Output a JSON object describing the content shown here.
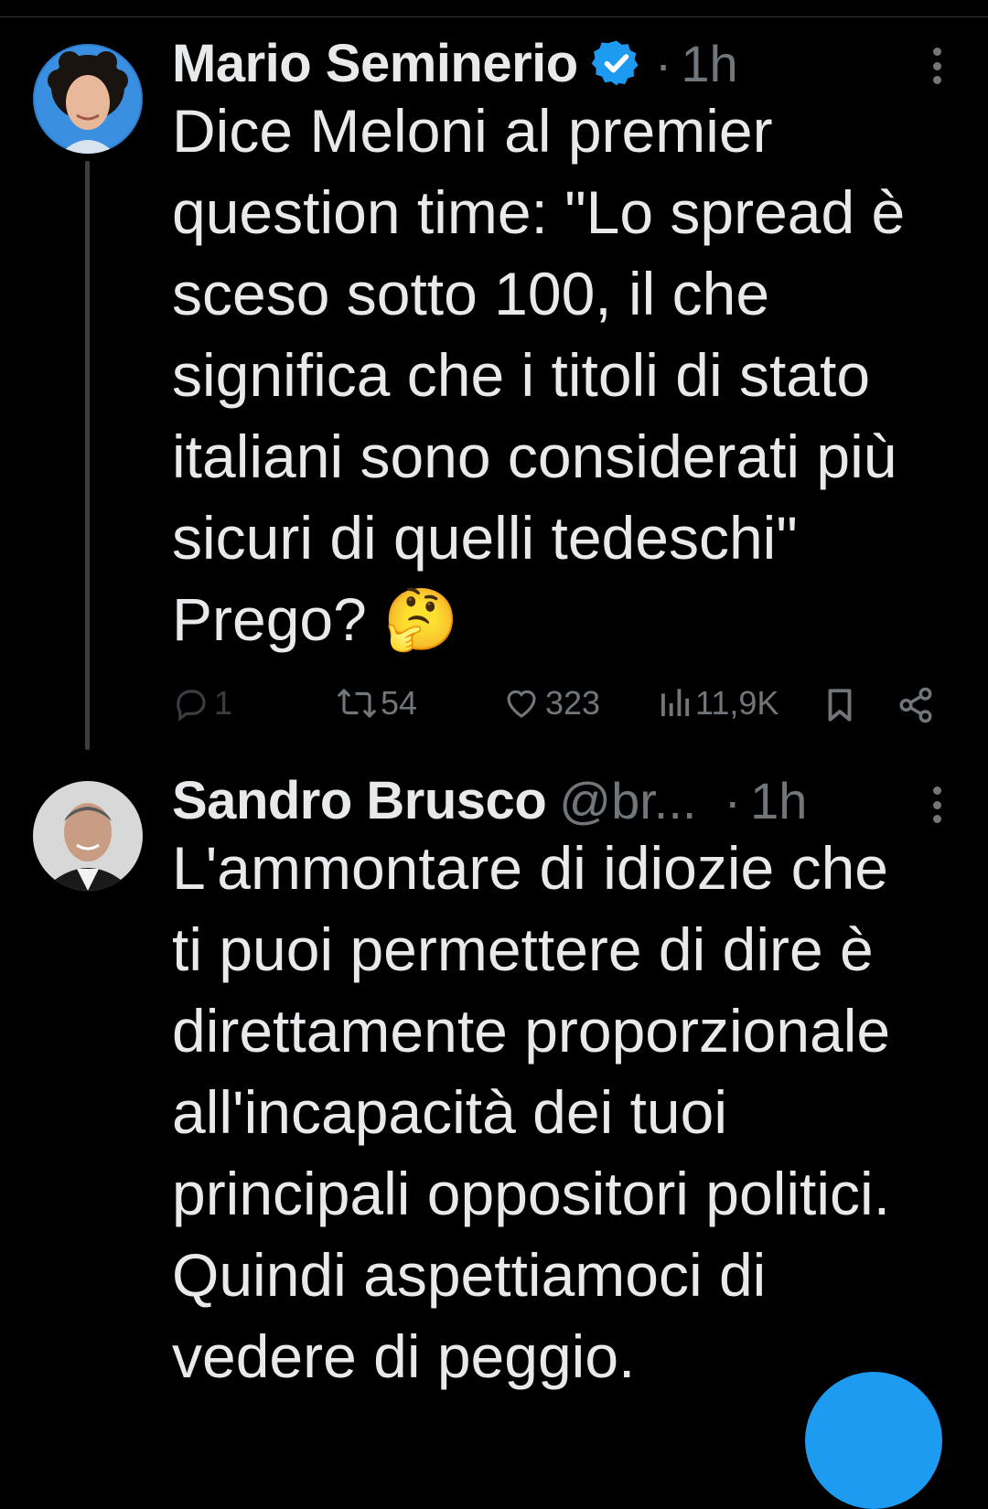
{
  "tweets": [
    {
      "name": "Mario Seminerio",
      "handle": "",
      "separator": "·",
      "time": "1h",
      "text": "Dice Meloni al premier\nquestion time: \"Lo spread è\nsceso sotto 100, il che\nsignifica che i titoli di stato\nitaliani sono considerati più\nsicuri di quelli tedeschi\"\nPrego? 🤔",
      "verified": true,
      "actions": {
        "replies": "1",
        "retweets": "54",
        "likes": "323",
        "views": "11,9K"
      }
    },
    {
      "name": "Sandro Brusco",
      "handle": "@br...",
      "separator": "·",
      "time": "1h",
      "text": "L'ammontare di idiozie che\nti puoi permettere di dire è\ndirettamente proporzionale\nall'incapacità dei tuoi\nprincipali oppositori politici.\nQuindi aspettiamoci di\nvedere di peggio."
    }
  ],
  "colors": {
    "background": "#000000",
    "text": "#e7e9ea",
    "secondary": "#71767b",
    "accent": "#1d9bf0"
  }
}
